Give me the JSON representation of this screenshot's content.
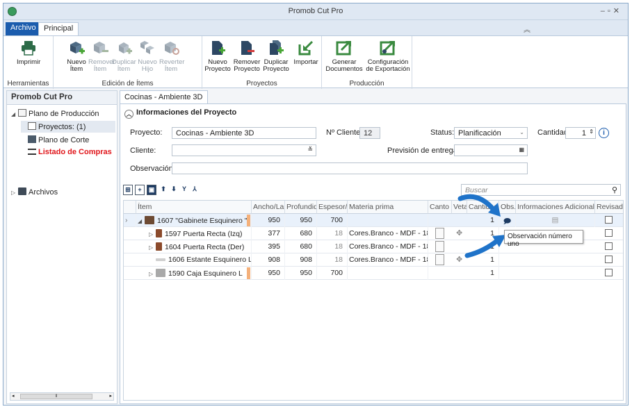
{
  "window": {
    "title": "Promob Cut Pro"
  },
  "ribbon_tabs": {
    "archivo": "Archivo",
    "principal": "Principal"
  },
  "ribbon": {
    "groups": {
      "herramientas": "Herramientas",
      "edicion": "Edición de Ítems",
      "proyectos": "Proyectos",
      "produccion": "Producción"
    },
    "buttons": {
      "imprimir": "Imprimir",
      "nuevo_item": "Nuevo\nÍtem",
      "remover_item": "Remover\nÍtem",
      "duplicar_item": "Duplicar\nÍtem",
      "nuevo_hijo": "Nuevo\nHijo",
      "revertir_item": "Reverter\nÍtem",
      "nuevo_proyecto": "Nuevo\nProyecto",
      "remover_proyecto": "Remover\nProyecto",
      "duplicar_proyecto": "Duplicar\nProyecto",
      "importar": "Importar",
      "generar_documentos": "Generar\nDocumentos",
      "configuracion_exportacion": "Configuración\nde Exportación"
    }
  },
  "left_panel": {
    "title": "Promob Cut Pro",
    "tree": {
      "plano_produccion": "Plano de Producción",
      "proyectos": "Proyectos: (1)",
      "plano_corte": "Plano de Corte",
      "listado_compras": "Listado de Compras",
      "archivos": "Archivos"
    }
  },
  "doc_tab": "Cocinas - Ambiente 3D",
  "project": {
    "section_title": "Informaciones del Proyecto",
    "proyecto_label": "Proyecto:",
    "proyecto_value": "Cocinas - Ambiente 3D",
    "ncliente_label": "Nº Cliente:",
    "ncliente_value": "12",
    "status_label": "Status:",
    "status_value": "Planificación",
    "cantidad_label": "Cantidad:",
    "cantidad_value": "1",
    "cliente_label": "Cliente:",
    "cliente_value": "",
    "prevision_label": "Previsión de entrega:",
    "prevision_value": "",
    "observacion_label": "Observación:",
    "observacion_value": ""
  },
  "search": {
    "placeholder": "Buscar"
  },
  "grid": {
    "columns": [
      "Ítem",
      "Ancho/Largo",
      "Profundidad",
      "Espesor/Alto",
      "Materia prima",
      "Canto",
      "Veta",
      "Cantidad",
      "Obs.",
      "Informaciones Adicionales",
      "Revisado"
    ],
    "rows": [
      {
        "item": "1607 \"Gabinete Esquinero \"",
        "ancho": "950",
        "prof": "950",
        "esp": "700",
        "materia": "",
        "cant": "1"
      },
      {
        "item": "1597 Puerta Recta (Izq)",
        "ancho": "377",
        "prof": "680",
        "esp": "18",
        "materia": "Cores.Branco - MDF - 18 (2",
        "cant": "1"
      },
      {
        "item": "1604 Puerta Recta (Der)",
        "ancho": "395",
        "prof": "680",
        "esp": "18",
        "materia": "Cores.Branco - MDF - 18 (2",
        "cant": "1"
      },
      {
        "item": "1606 Estante Esquinero L",
        "ancho": "908",
        "prof": "908",
        "esp": "18",
        "materia": "Cores.Branco - MDF - 18 (2",
        "cant": "1"
      },
      {
        "item": "1590 Caja Esquinero L",
        "ancho": "950",
        "prof": "950",
        "esp": "700",
        "materia": "",
        "cant": "1"
      }
    ]
  },
  "tooltip": "Observación número uno",
  "colors": {
    "accent": "#1b5cad",
    "arrow": "#1f73c9",
    "red_link": "#e0161b",
    "orange_marker": "#f4b07a"
  }
}
